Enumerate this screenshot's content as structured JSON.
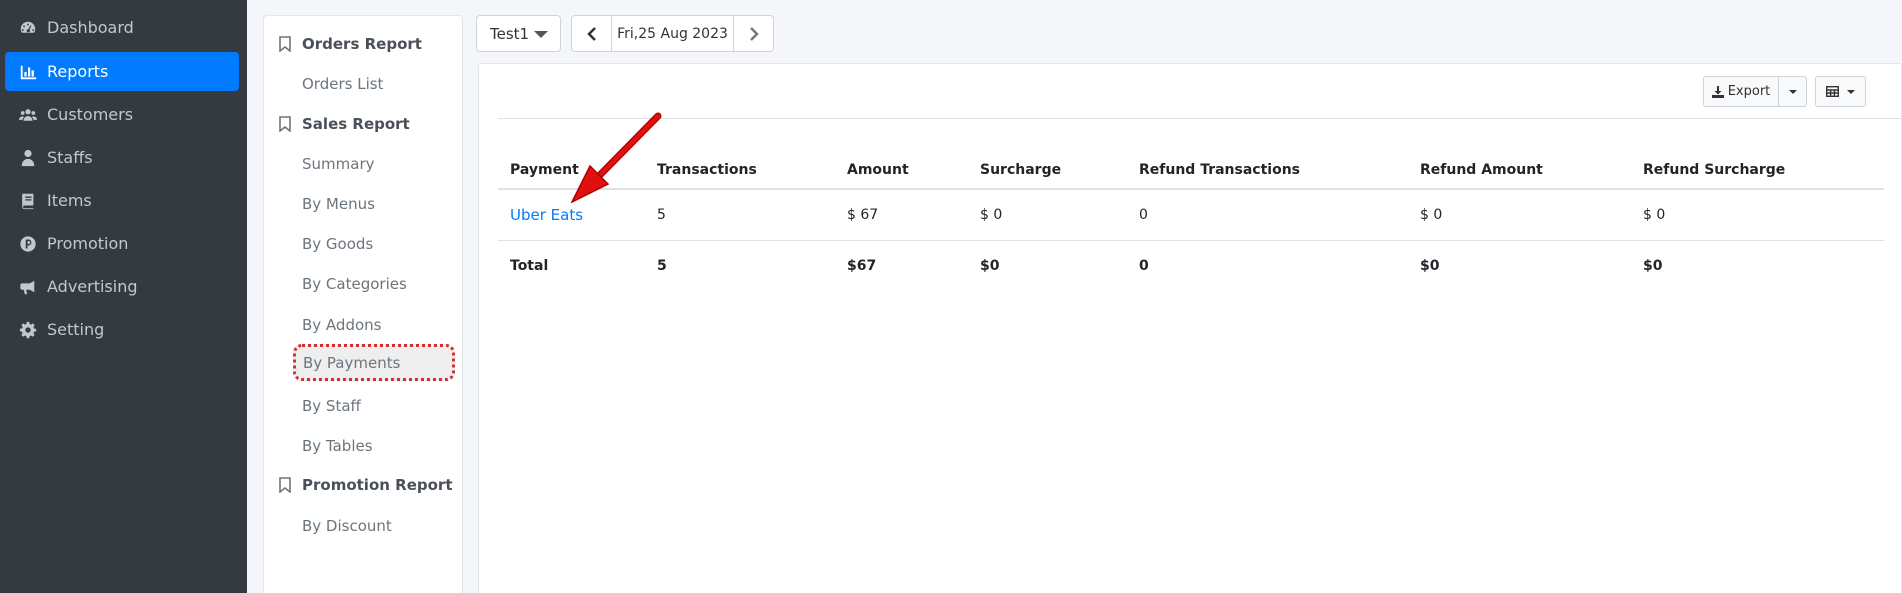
{
  "sidebar": {
    "items": [
      {
        "label": "Dashboard",
        "icon": "dashboard-icon",
        "active": false
      },
      {
        "label": "Reports",
        "icon": "bar-chart-icon",
        "active": true
      },
      {
        "label": "Customers",
        "icon": "users-icon",
        "active": false
      },
      {
        "label": "Staffs",
        "icon": "staff-icon",
        "active": false
      },
      {
        "label": "Items",
        "icon": "book-icon",
        "active": false
      },
      {
        "label": "Promotion",
        "icon": "promotion-icon",
        "active": false
      },
      {
        "label": "Advertising",
        "icon": "megaphone-icon",
        "active": false
      },
      {
        "label": "Setting",
        "icon": "gear-icon",
        "active": false
      }
    ]
  },
  "report_menu": {
    "orders_title": "Orders Report",
    "orders_list": "Orders List",
    "sales_title": "Sales Report",
    "summary": "Summary",
    "by_menus": "By Menus",
    "by_goods": "By Goods",
    "by_categories": "By Categories",
    "by_addons": "By Addons",
    "by_payments": "By Payments",
    "by_staff": "By Staff",
    "by_tables": "By Tables",
    "promotion_title": "Promotion Report",
    "by_discount": "By Discount",
    "selected": "By Payments"
  },
  "toolbar": {
    "branch": "Test1",
    "date": "Fri,25 Aug 2023",
    "export_label": "Export"
  },
  "table": {
    "headers": [
      "Payment",
      "Transactions",
      "Amount",
      "Surcharge",
      "Refund Transactions",
      "Refund Amount",
      "Refund Surcharge"
    ],
    "rows": [
      [
        "Uber Eats",
        "5",
        "$ 67",
        "$ 0",
        "0",
        "$ 0",
        "$ 0"
      ]
    ],
    "total": [
      "Total",
      "5",
      "$67",
      "$0",
      "0",
      "$0",
      "$0"
    ]
  },
  "colors": {
    "sidebar_bg": "#343a40",
    "active": "#007bff",
    "link": "#007bff",
    "highlight_border": "#d32f2f",
    "arrow": "#e01010"
  }
}
